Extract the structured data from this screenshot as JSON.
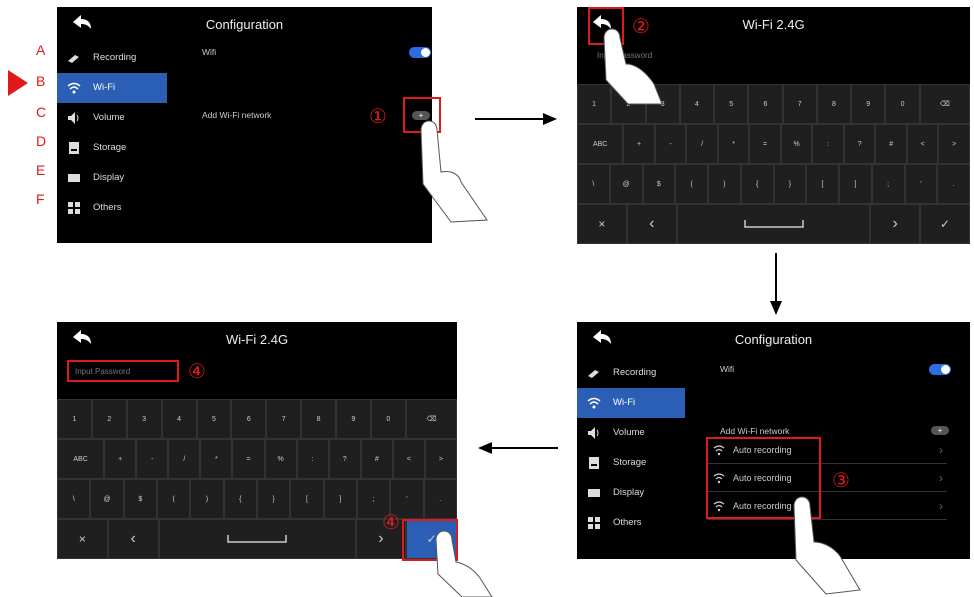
{
  "config": {
    "title": "Configuration",
    "sidebar": [
      {
        "label": "Recording",
        "icon": "recording-icon"
      },
      {
        "label": "Wi-Fi",
        "icon": "wifi-icon",
        "active": true
      },
      {
        "label": "Volume",
        "icon": "speaker-icon"
      },
      {
        "label": "Storage",
        "icon": "storage-icon"
      },
      {
        "label": "Display",
        "icon": "display-icon"
      },
      {
        "label": "Others",
        "icon": "grid-icon"
      }
    ],
    "wifi_label": "Wifi",
    "add_network_label": "Add Wi-Fi network",
    "plus": "+",
    "networks": [
      "Auto recording",
      "Auto recording",
      "Auto recording"
    ]
  },
  "letters": [
    "A",
    "B",
    "C",
    "D",
    "E",
    "F"
  ],
  "wifi_screen": {
    "title": "Wi-Fi 2.4G",
    "password_placeholder": "Input Password"
  },
  "keyboard": {
    "row1": [
      "1",
      "2",
      "3",
      "4",
      "5",
      "6",
      "7",
      "8",
      "9",
      "0",
      "⌫"
    ],
    "row2": [
      "ABC",
      "+",
      "-",
      "/",
      "*",
      "=",
      "%",
      ":",
      "?",
      "#",
      "<",
      ">"
    ],
    "row3": [
      "\\",
      "@",
      "$",
      "(",
      ")",
      "{",
      "}",
      "[",
      "]",
      ";",
      "'",
      "."
    ],
    "row4": [
      "×",
      "‹",
      "",
      "›",
      "✓"
    ]
  },
  "steps": [
    "①",
    "②",
    "③",
    "④",
    "④"
  ],
  "colors": {
    "accent": "#2a5fb5",
    "toggle": "#2a6ee0",
    "annotation": "#e01a1a"
  }
}
